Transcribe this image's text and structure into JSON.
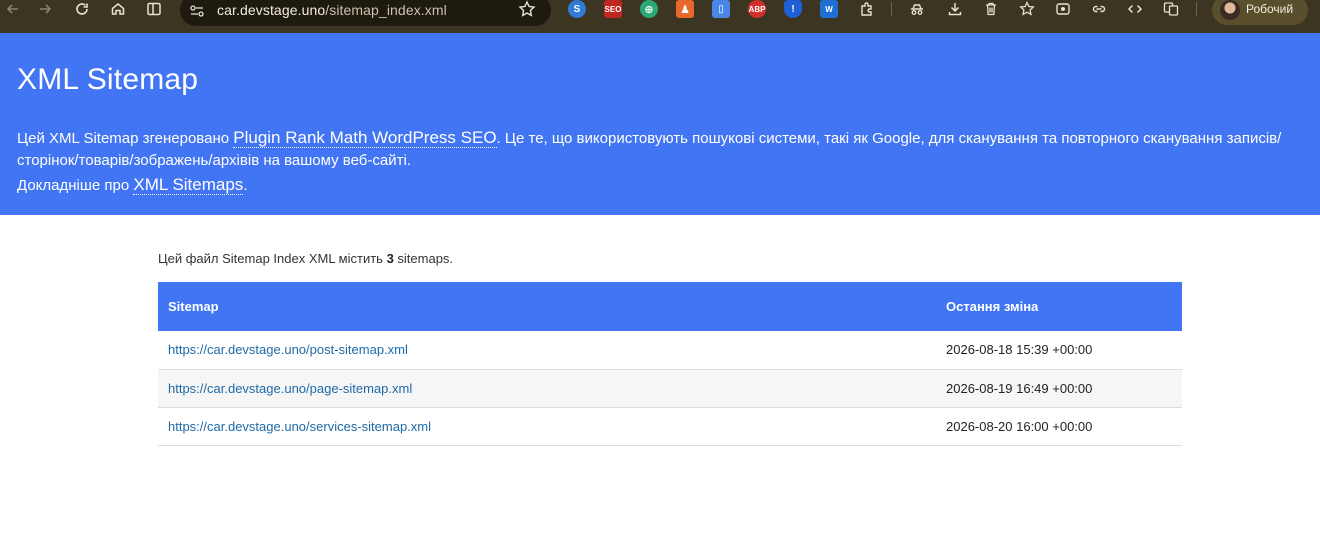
{
  "browser": {
    "url_host": "car.devstage.uno",
    "url_path": "/sitemap_index.xml",
    "profile_name": "Робочий",
    "extensions": [
      {
        "name": "s-blue",
        "label": "",
        "color": "#2f7bd6"
      },
      {
        "name": "seo",
        "label": "SEO",
        "color": "#c0261f"
      },
      {
        "name": "globe",
        "label": "",
        "color": "#2aa876"
      },
      {
        "name": "figure",
        "label": "",
        "color": "#e8672a"
      },
      {
        "name": "docs",
        "label": "",
        "color": "#4a86e8"
      },
      {
        "name": "abp",
        "label": "ABP",
        "color": "#d32f2f"
      },
      {
        "name": "shield",
        "label": "",
        "color": "#1e5fd6"
      },
      {
        "name": "w",
        "label": "W",
        "color": "#1f6ed4"
      }
    ]
  },
  "banner": {
    "title": "XML Sitemap",
    "desc_before": "Цей XML Sitemap згенеровано ",
    "desc_link": "Plugin Rank Math WordPress SEO",
    "desc_after": ". Це те, що використовують пошукові системи, такі як Google, для сканування та повторного сканування записів/сторінок/товарів/зображень/архівів на вашому веб-сайті.",
    "more_before": "Докладніше про ",
    "more_link": "XML Sitemaps",
    "more_after": "."
  },
  "main": {
    "intro_before": "Цей файл Sitemap Index XML містить ",
    "intro_count": "3",
    "intro_after": " sitemaps.",
    "table": {
      "headers": [
        "Sitemap",
        "Остання зміна"
      ],
      "rows": [
        {
          "url": "https://car.devstage.uno/post-sitemap.xml",
          "modified": "2026-08-18 15:39 +00:00"
        },
        {
          "url": "https://car.devstage.uno/page-sitemap.xml",
          "modified": "2026-08-19 16:49 +00:00"
        },
        {
          "url": "https://car.devstage.uno/services-sitemap.xml",
          "modified": "2026-08-20 16:00 +00:00"
        }
      ]
    }
  },
  "colors": {
    "accent": "#4275f4",
    "link": "#1e6aa8",
    "toolbar": "#3b3521"
  }
}
